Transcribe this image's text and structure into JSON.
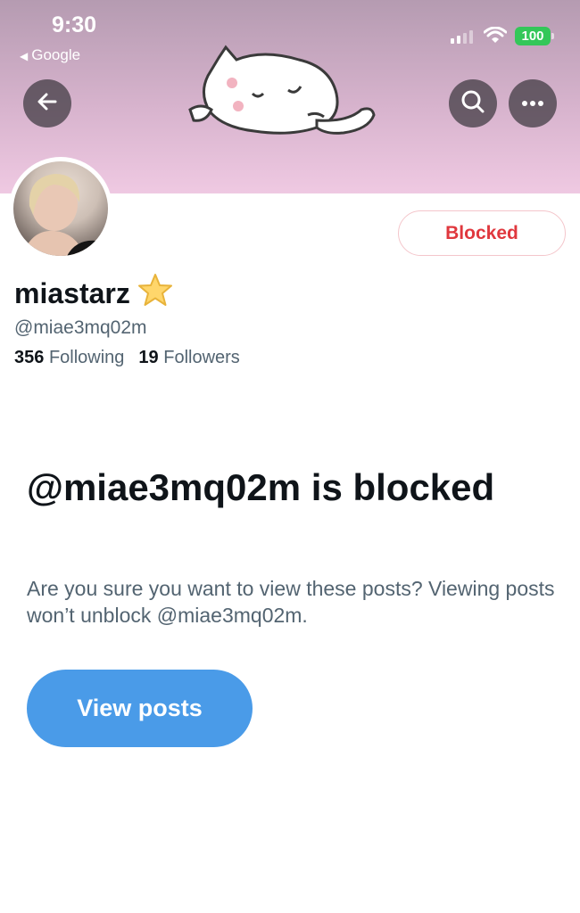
{
  "status_bar": {
    "time": "9:30",
    "back_app": "Google",
    "battery": "100"
  },
  "profile": {
    "blocked_label": "Blocked",
    "display_name": "miastarz",
    "badge_emoji": "⭐",
    "handle": "@miae3mq02m",
    "following_count": "356",
    "following_label": "Following",
    "followers_count": "19",
    "followers_label": "Followers"
  },
  "blocked_notice": {
    "title": "@miae3mq02m is blocked",
    "description": "Are you sure you want to view these posts? Viewing posts won’t unblock @miae3mq02m.",
    "button": "View posts"
  },
  "icons": {
    "back": "arrow-left-icon",
    "search": "search-icon",
    "more": "more-icon"
  },
  "colors": {
    "blocked_red": "#e0383e",
    "view_button": "#4a9be8",
    "secondary_text": "#536471"
  }
}
